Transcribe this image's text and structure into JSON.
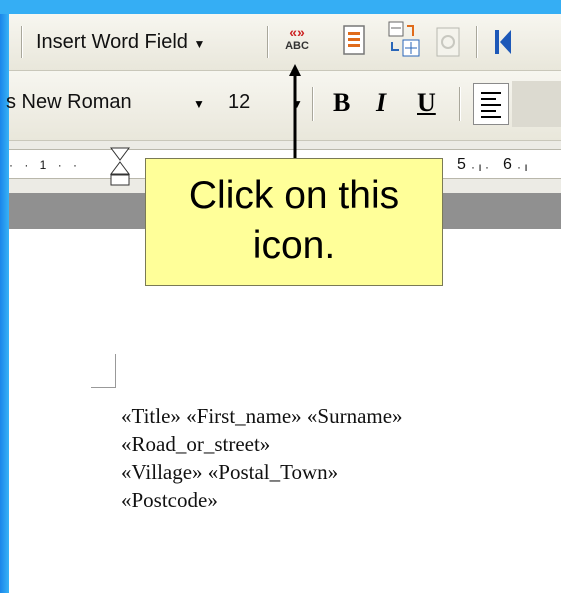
{
  "toolbar_mailmerge": {
    "insert_word_field_label": "Insert Word Field",
    "merge_field_icon_label": "ABC",
    "icons": [
      "view-merged-data-icon",
      "mail-merge-document-icon",
      "match-fields-icon",
      "propagate-labels-icon",
      "first-record-icon"
    ]
  },
  "toolbar_format": {
    "font_name": "s New Roman",
    "font_size": "12",
    "bold_label": "B",
    "italic_label": "I",
    "underline_label": "U"
  },
  "ruler": {
    "left_number": "1",
    "right_numbers": [
      "5",
      "6"
    ]
  },
  "callout": {
    "line1": "Click on this",
    "line2": "icon."
  },
  "document": {
    "lines": [
      "«Title» «First_name» «Surname»",
      "«Road_or_street»",
      "«Village» «Postal_Town»",
      "«Postcode»"
    ]
  },
  "colors": {
    "frame_blue": "#1a86ea",
    "callout_fill": "#ffff99",
    "toolbar_bg": "#ece9d8",
    "merge_icon_red": "#cc2222"
  }
}
